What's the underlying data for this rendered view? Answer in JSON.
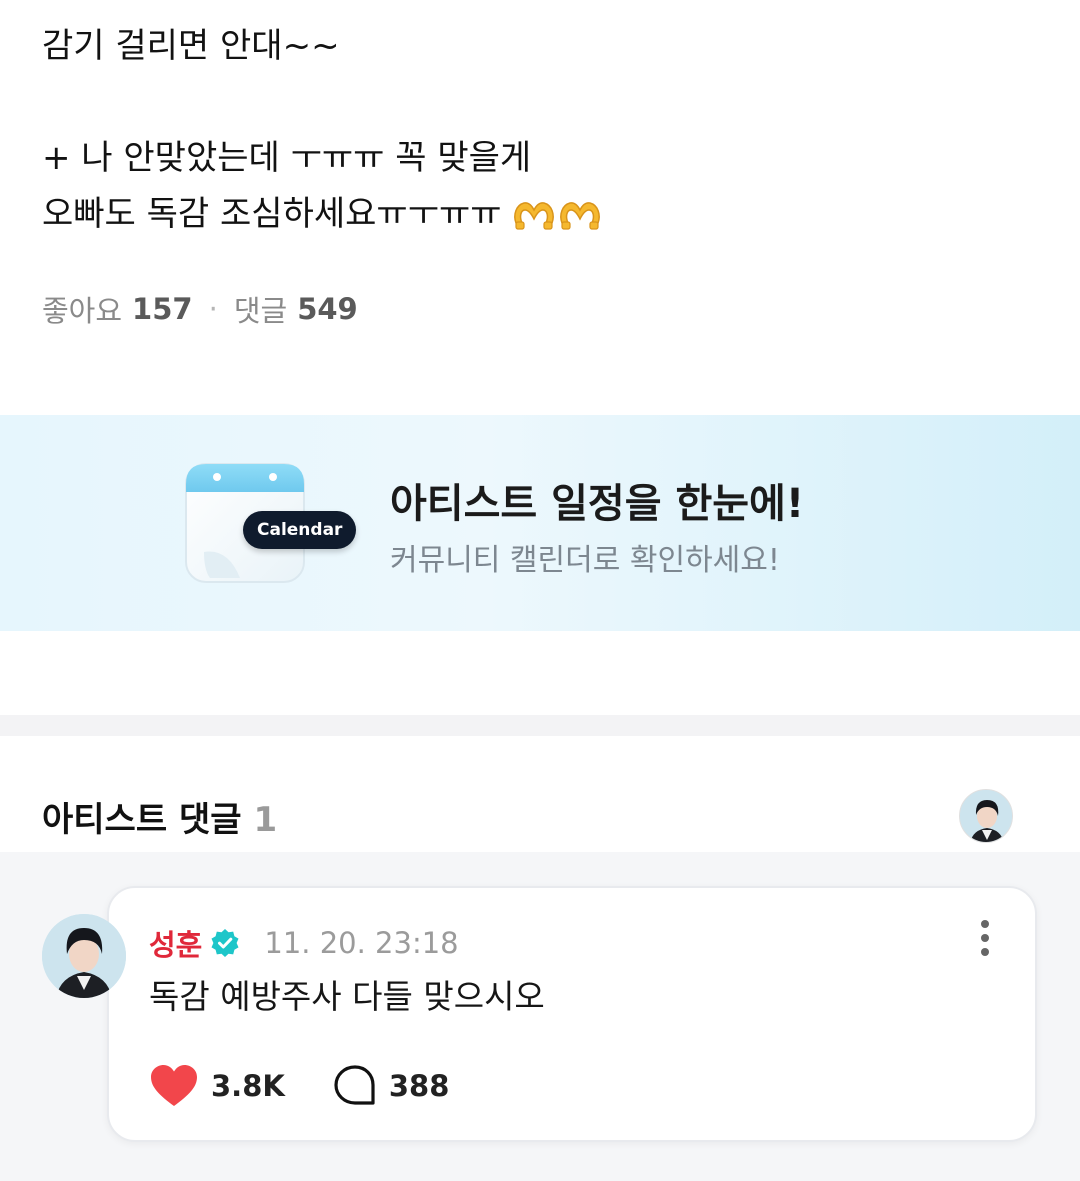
{
  "post": {
    "lines": [
      "감기 걸리면 안대~~",
      "",
      "+ 나 안맞았는데 ㅜㅠㅠ 꼭 맞을게",
      "오빠도 독감 조심하세요ㅠㅜㅠㅠ"
    ],
    "emoji": "heart-hands-emoji"
  },
  "stats": {
    "likes_label": "좋아요",
    "likes_count": "157",
    "comments_label": "댓글",
    "comments_count": "549"
  },
  "banner": {
    "badge_label": "Calendar",
    "title": "아티스트 일정을 한눈에!",
    "subtitle": "커뮤니티 캘린더로 확인하세요!",
    "accent_color": "#7fd3f3"
  },
  "artist_comments": {
    "title": "아티스트 댓글",
    "count": "1"
  },
  "comment": {
    "author": "성훈",
    "author_color": "#e0283a",
    "verified_color": "#1ec6c9",
    "time": "11. 20. 23:18",
    "text": "독감 예방주사 다들 맞으시오",
    "like_count": "3.8K",
    "reply_count": "388",
    "heart_color": "#f2464b"
  }
}
